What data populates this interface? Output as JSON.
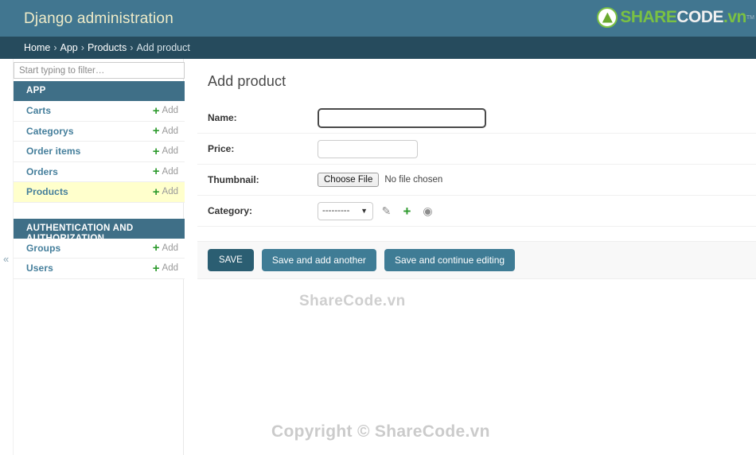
{
  "header": {
    "site_title": "Django administration",
    "logo": {
      "icon": "sharecode-circle-logo",
      "part_share": "SHARE",
      "part_code": "CODE",
      "part_vn": ".vn",
      "trademark": "TM"
    },
    "colors": {
      "header_bg": "#417690",
      "breadcrumb_bg": "#264b5d",
      "title_color": "#f0ecc8",
      "accent_green": "#7ac143",
      "link_blue": "#447e9b",
      "button_blue": "#3f7c95",
      "save_blue": "#2b5e72",
      "highlight_yellow": "#ffffcc"
    }
  },
  "breadcrumbs": {
    "items": [
      {
        "label": "Home",
        "current": false
      },
      {
        "label": "App",
        "current": false
      },
      {
        "label": "Products",
        "current": false
      },
      {
        "label": "Add product",
        "current": true
      }
    ],
    "separator": "›"
  },
  "sidebar": {
    "filter": {
      "placeholder": "Start typing to filter…",
      "value": ""
    },
    "toggle_icon": "«",
    "modules": [
      {
        "caption": "APP",
        "models": [
          {
            "name": "Carts",
            "add_label": "Add",
            "highlighted": false
          },
          {
            "name": "Categorys",
            "add_label": "Add",
            "highlighted": false
          },
          {
            "name": "Order items",
            "add_label": "Add",
            "highlighted": false
          },
          {
            "name": "Orders",
            "add_label": "Add",
            "highlighted": false
          },
          {
            "name": "Products",
            "add_label": "Add",
            "highlighted": true
          }
        ]
      },
      {
        "caption": "AUTHENTICATION AND AUTHORIZATION",
        "models": [
          {
            "name": "Groups",
            "add_label": "Add",
            "highlighted": false
          },
          {
            "name": "Users",
            "add_label": "Add",
            "highlighted": false
          }
        ]
      }
    ]
  },
  "main": {
    "page_title": "Add product",
    "fields": {
      "name": {
        "label": "Name:",
        "value": "",
        "focused": true
      },
      "price": {
        "label": "Price:",
        "value": ""
      },
      "thumbnail": {
        "label": "Thumbnail:",
        "choose_button": "Choose File",
        "status": "No file chosen"
      },
      "category": {
        "label": "Category:",
        "selected_option": "---------",
        "options": [
          "---------"
        ],
        "edit_icon": "pencil-icon",
        "add_icon": "plus-icon",
        "view_icon": "eye-icon"
      }
    },
    "submit_row": {
      "save": "SAVE",
      "save_and_add_another": "Save and add another",
      "save_and_continue": "Save and continue editing"
    }
  },
  "watermarks": {
    "middle": "ShareCode.vn",
    "footer": "Copyright © ShareCode.vn"
  }
}
